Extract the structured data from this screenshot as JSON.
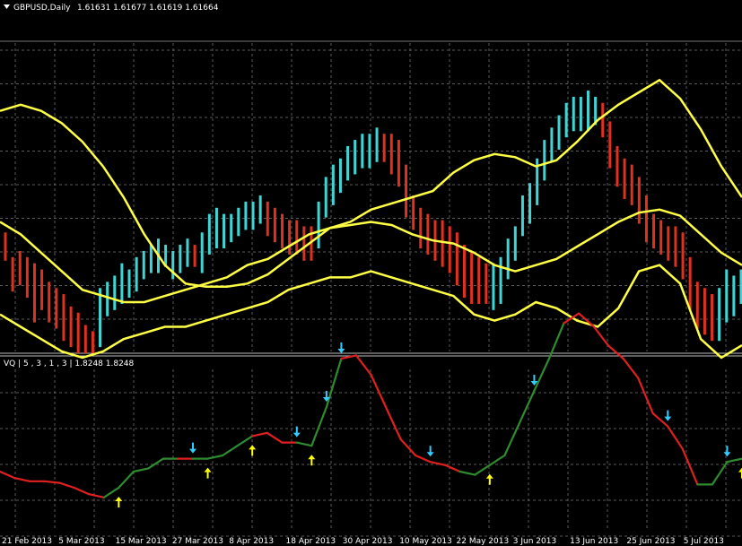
{
  "window": {
    "title": "GBPUSD,Daily",
    "ohlc": "1.61631 1.61677 1.61619 1.61664"
  },
  "indicator": {
    "label": "VQ | 5 , 3 , 1 , 3 | 1.8248 1.8248"
  },
  "colors": {
    "background": "#000000",
    "grid": "#5a5a5a",
    "bull_bar": "#3fd5d5",
    "bear_bar": "#e0301e",
    "bands": "#ffff44",
    "vq_up": "#2e8b2e",
    "vq_down": "#e02020",
    "arrow_up": "#ffff00",
    "arrow_down": "#33ccff",
    "text": "#ffffff"
  },
  "chart_data": [
    {
      "type": "ohlc_bars_with_bollinger_bands",
      "symbol": "GBPUSD",
      "timeframe": "Daily",
      "grid": true,
      "x_tick_labels": [
        "21 Feb 2013",
        "5 Mar 2013",
        "15 Mar 2013",
        "27 Mar 2013",
        "8 Apr 2013",
        "18 Apr 2013",
        "30 Apr 2013",
        "10 May 2013",
        "22 May 2013",
        "3 Jun 2013",
        "13 Jun 2013",
        "25 Jun 2013",
        "5 Jul 2013"
      ],
      "y_axis_scale_hidden": true,
      "bars": [
        {
          "c": "bear",
          "o": 0.62,
          "cl": 0.7
        },
        {
          "c": "bear",
          "o": 0.7,
          "cl": 0.8
        },
        {
          "c": "bear",
          "o": 0.68,
          "cl": 0.78
        },
        {
          "c": "bear",
          "o": 0.7,
          "cl": 0.82
        },
        {
          "c": "bear",
          "o": 0.72,
          "cl": 0.9
        },
        {
          "c": "bear",
          "o": 0.74,
          "cl": 0.86
        },
        {
          "c": "bear",
          "o": 0.78,
          "cl": 0.9
        },
        {
          "c": "bear",
          "o": 0.8,
          "cl": 0.92
        },
        {
          "c": "bear",
          "o": 0.82,
          "cl": 0.96
        },
        {
          "c": "bear",
          "o": 0.86,
          "cl": 0.98
        },
        {
          "c": "bear",
          "o": 0.88,
          "cl": 1.0
        },
        {
          "c": "bear",
          "o": 0.92,
          "cl": 1.0
        },
        {
          "c": "bear",
          "o": 0.94,
          "cl": 1.0
        },
        {
          "c": "bull",
          "o": 0.98,
          "cl": 0.8
        },
        {
          "c": "bull",
          "o": 0.88,
          "cl": 0.78
        },
        {
          "c": "bull",
          "o": 0.86,
          "cl": 0.76
        },
        {
          "c": "bull",
          "o": 0.84,
          "cl": 0.72
        },
        {
          "c": "bull",
          "o": 0.82,
          "cl": 0.74
        },
        {
          "c": "bull",
          "o": 0.8,
          "cl": 0.7
        },
        {
          "c": "bull",
          "o": 0.76,
          "cl": 0.68
        },
        {
          "c": "bull",
          "o": 0.74,
          "cl": 0.66
        },
        {
          "c": "bull",
          "o": 0.74,
          "cl": 0.64
        },
        {
          "c": "bull",
          "o": 0.72,
          "cl": 0.66
        },
        {
          "c": "bull",
          "o": 0.76,
          "cl": 0.68
        },
        {
          "c": "bull",
          "o": 0.74,
          "cl": 0.66
        },
        {
          "c": "bull",
          "o": 0.72,
          "cl": 0.64
        },
        {
          "c": "bear",
          "o": 0.66,
          "cl": 0.72
        },
        {
          "c": "bull",
          "o": 0.74,
          "cl": 0.62
        },
        {
          "c": "bull",
          "o": 0.68,
          "cl": 0.56
        },
        {
          "c": "bull",
          "o": 0.66,
          "cl": 0.54
        },
        {
          "c": "bull",
          "o": 0.66,
          "cl": 0.56
        },
        {
          "c": "bull",
          "o": 0.64,
          "cl": 0.56
        },
        {
          "c": "bull",
          "o": 0.62,
          "cl": 0.54
        },
        {
          "c": "bull",
          "o": 0.6,
          "cl": 0.52
        },
        {
          "c": "bull",
          "o": 0.6,
          "cl": 0.52
        },
        {
          "c": "bull",
          "o": 0.58,
          "cl": 0.5
        },
        {
          "c": "bear",
          "o": 0.52,
          "cl": 0.62
        },
        {
          "c": "bear",
          "o": 0.54,
          "cl": 0.64
        },
        {
          "c": "bear",
          "o": 0.56,
          "cl": 0.66
        },
        {
          "c": "bear",
          "o": 0.58,
          "cl": 0.68
        },
        {
          "c": "bear",
          "o": 0.58,
          "cl": 0.68
        },
        {
          "c": "bear",
          "o": 0.6,
          "cl": 0.7
        },
        {
          "c": "bear",
          "o": 0.6,
          "cl": 0.7
        },
        {
          "c": "bull",
          "o": 0.66,
          "cl": 0.52
        },
        {
          "c": "bull",
          "o": 0.56,
          "cl": 0.44
        },
        {
          "c": "bull",
          "o": 0.52,
          "cl": 0.4
        },
        {
          "c": "bull",
          "o": 0.48,
          "cl": 0.38
        },
        {
          "c": "bull",
          "o": 0.44,
          "cl": 0.34
        },
        {
          "c": "bull",
          "o": 0.42,
          "cl": 0.32
        },
        {
          "c": "bull",
          "o": 0.4,
          "cl": 0.3
        },
        {
          "c": "bull",
          "o": 0.4,
          "cl": 0.3
        },
        {
          "c": "bull",
          "o": 0.38,
          "cl": 0.28
        },
        {
          "c": "bear",
          "o": 0.3,
          "cl": 0.38
        },
        {
          "c": "bear",
          "o": 0.3,
          "cl": 0.42
        },
        {
          "c": "bear",
          "o": 0.32,
          "cl": 0.46
        },
        {
          "c": "bear",
          "o": 0.4,
          "cl": 0.56
        },
        {
          "c": "bear",
          "o": 0.5,
          "cl": 0.6
        },
        {
          "c": "bear",
          "o": 0.54,
          "cl": 0.66
        },
        {
          "c": "bear",
          "o": 0.56,
          "cl": 0.68
        },
        {
          "c": "bear",
          "o": 0.58,
          "cl": 0.7
        },
        {
          "c": "bear",
          "o": 0.58,
          "cl": 0.72
        },
        {
          "c": "bear",
          "o": 0.6,
          "cl": 0.74
        },
        {
          "c": "bear",
          "o": 0.62,
          "cl": 0.78
        },
        {
          "c": "bear",
          "o": 0.66,
          "cl": 0.82
        },
        {
          "c": "bear",
          "o": 0.68,
          "cl": 0.84
        },
        {
          "c": "bear",
          "o": 0.7,
          "cl": 0.84
        },
        {
          "c": "bear",
          "o": 0.72,
          "cl": 0.84
        },
        {
          "c": "bull",
          "o": 0.86,
          "cl": 0.72
        },
        {
          "c": "bull",
          "o": 0.84,
          "cl": 0.7
        },
        {
          "c": "bull",
          "o": 0.76,
          "cl": 0.64
        },
        {
          "c": "bull",
          "o": 0.7,
          "cl": 0.6
        },
        {
          "c": "bull",
          "o": 0.62,
          "cl": 0.5
        },
        {
          "c": "bull",
          "o": 0.58,
          "cl": 0.46
        },
        {
          "c": "bull",
          "o": 0.52,
          "cl": 0.38
        },
        {
          "c": "bull",
          "o": 0.44,
          "cl": 0.32
        },
        {
          "c": "bull",
          "o": 0.38,
          "cl": 0.28
        },
        {
          "c": "bull",
          "o": 0.34,
          "cl": 0.24
        },
        {
          "c": "bull",
          "o": 0.3,
          "cl": 0.2
        },
        {
          "c": "bull",
          "o": 0.28,
          "cl": 0.18
        },
        {
          "c": "bull",
          "o": 0.28,
          "cl": 0.18
        },
        {
          "c": "bull",
          "o": 0.28,
          "cl": 0.16
        },
        {
          "c": "bull",
          "o": 0.26,
          "cl": 0.18
        },
        {
          "c": "bear",
          "o": 0.2,
          "cl": 0.3
        },
        {
          "c": "bear",
          "o": 0.26,
          "cl": 0.4
        },
        {
          "c": "bear",
          "o": 0.34,
          "cl": 0.46
        },
        {
          "c": "bear",
          "o": 0.38,
          "cl": 0.5
        },
        {
          "c": "bear",
          "o": 0.4,
          "cl": 0.52
        },
        {
          "c": "bear",
          "o": 0.44,
          "cl": 0.58
        },
        {
          "c": "bear",
          "o": 0.5,
          "cl": 0.64
        },
        {
          "c": "bear",
          "o": 0.56,
          "cl": 0.66
        },
        {
          "c": "bear",
          "o": 0.58,
          "cl": 0.68
        },
        {
          "c": "bear",
          "o": 0.6,
          "cl": 0.7
        },
        {
          "c": "bear",
          "o": 0.6,
          "cl": 0.72
        },
        {
          "c": "bear",
          "o": 0.62,
          "cl": 0.76
        },
        {
          "c": "bear",
          "o": 0.7,
          "cl": 0.86
        },
        {
          "c": "bear",
          "o": 0.78,
          "cl": 0.92
        },
        {
          "c": "bear",
          "o": 0.8,
          "cl": 0.94
        },
        {
          "c": "bear",
          "o": 0.82,
          "cl": 0.96
        },
        {
          "c": "bull",
          "o": 0.96,
          "cl": 0.8
        },
        {
          "c": "bull",
          "o": 0.9,
          "cl": 0.74
        },
        {
          "c": "bull",
          "o": 0.88,
          "cl": 0.76
        },
        {
          "c": "bull",
          "o": 0.84,
          "cl": 0.74
        }
      ],
      "bands": {
        "upper": [
          0.22,
          0.2,
          0.22,
          0.26,
          0.32,
          0.4,
          0.5,
          0.62,
          0.72,
          0.78,
          0.79,
          0.79,
          0.78,
          0.75,
          0.7,
          0.65,
          0.6,
          0.58,
          0.54,
          0.52,
          0.5,
          0.48,
          0.42,
          0.38,
          0.36,
          0.37,
          0.4,
          0.38,
          0.32,
          0.25,
          0.2,
          0.16,
          0.12,
          0.18,
          0.28,
          0.4,
          0.5
        ],
        "middle": [
          0.58,
          0.62,
          0.68,
          0.74,
          0.8,
          0.82,
          0.84,
          0.84,
          0.82,
          0.8,
          0.78,
          0.76,
          0.72,
          0.7,
          0.66,
          0.62,
          0.6,
          0.59,
          0.58,
          0.59,
          0.62,
          0.64,
          0.65,
          0.68,
          0.72,
          0.74,
          0.72,
          0.7,
          0.66,
          0.62,
          0.58,
          0.55,
          0.54,
          0.56,
          0.62,
          0.68,
          0.72
        ],
        "lower": [
          0.88,
          0.92,
          0.96,
          1.0,
          1.02,
          1.0,
          0.96,
          0.94,
          0.92,
          0.92,
          0.9,
          0.88,
          0.86,
          0.84,
          0.8,
          0.78,
          0.76,
          0.76,
          0.74,
          0.76,
          0.78,
          0.8,
          0.82,
          0.88,
          0.9,
          0.88,
          0.84,
          0.86,
          0.9,
          0.92,
          0.86,
          0.74,
          0.72,
          0.78,
          0.96,
          1.02,
          0.98
        ]
      }
    },
    {
      "type": "line",
      "name": "VQ",
      "params": "5 , 3 , 1 , 3",
      "values_label": "1.8248 1.8248",
      "grid": true,
      "vq_points": [
        {
          "v": 0.3,
          "c": "down"
        },
        {
          "v": 0.34,
          "c": "down"
        },
        {
          "v": 0.36,
          "c": "down"
        },
        {
          "v": 0.36,
          "c": "down"
        },
        {
          "v": 0.37,
          "c": "down"
        },
        {
          "v": 0.4,
          "c": "down"
        },
        {
          "v": 0.44,
          "c": "down"
        },
        {
          "v": 0.46,
          "c": "down"
        },
        {
          "v": 0.4,
          "c": "up"
        },
        {
          "v": 0.3,
          "c": "up"
        },
        {
          "v": 0.28,
          "c": "up"
        },
        {
          "v": 0.22,
          "c": "up"
        },
        {
          "v": 0.22,
          "c": "up"
        },
        {
          "v": 0.22,
          "c": "down"
        },
        {
          "v": 0.22,
          "c": "up"
        },
        {
          "v": 0.2,
          "c": "up"
        },
        {
          "v": 0.14,
          "c": "up"
        },
        {
          "v": 0.08,
          "c": "up"
        },
        {
          "v": 0.06,
          "c": "down"
        },
        {
          "v": 0.12,
          "c": "down"
        },
        {
          "v": 0.12,
          "c": "down"
        },
        {
          "v": 0.14,
          "c": "up"
        },
        {
          "v": -0.1,
          "c": "up"
        },
        {
          "v": -0.4,
          "c": "up"
        },
        {
          "v": -0.42,
          "c": "down"
        },
        {
          "v": -0.3,
          "c": "down"
        },
        {
          "v": -0.1,
          "c": "down"
        },
        {
          "v": 0.1,
          "c": "down"
        },
        {
          "v": 0.2,
          "c": "down"
        },
        {
          "v": 0.24,
          "c": "down"
        },
        {
          "v": 0.26,
          "c": "down"
        },
        {
          "v": 0.3,
          "c": "down"
        },
        {
          "v": 0.32,
          "c": "up"
        },
        {
          "v": 0.26,
          "c": "up"
        },
        {
          "v": 0.2,
          "c": "up"
        },
        {
          "v": 0.0,
          "c": "up"
        },
        {
          "v": -0.2,
          "c": "up"
        },
        {
          "v": -0.4,
          "c": "up"
        },
        {
          "v": -0.62,
          "c": "up"
        },
        {
          "v": -0.68,
          "c": "down"
        },
        {
          "v": -0.6,
          "c": "down"
        },
        {
          "v": -0.48,
          "c": "down"
        },
        {
          "v": -0.4,
          "c": "down"
        },
        {
          "v": -0.28,
          "c": "down"
        },
        {
          "v": -0.06,
          "c": "down"
        },
        {
          "v": 0.02,
          "c": "down"
        },
        {
          "v": 0.16,
          "c": "down"
        },
        {
          "v": 0.38,
          "c": "down"
        },
        {
          "v": 0.38,
          "c": "up"
        },
        {
          "v": 0.24,
          "c": "up"
        },
        {
          "v": 0.22,
          "c": "up"
        }
      ],
      "signals_up": [
        8,
        14,
        17,
        21,
        33,
        50,
        52
      ],
      "signals_down": [
        13,
        20,
        22,
        23,
        29,
        36,
        45,
        49
      ]
    }
  ]
}
